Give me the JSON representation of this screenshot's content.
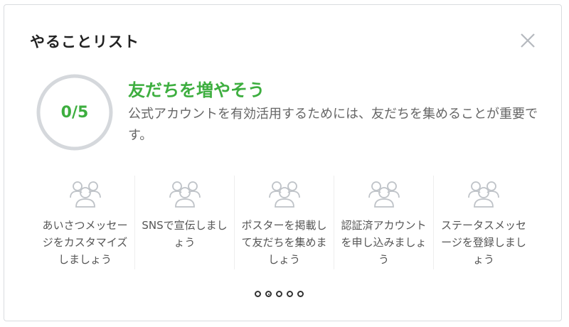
{
  "panel": {
    "title": "やることリスト",
    "close_icon": "close-icon"
  },
  "progress": {
    "text": "0/5",
    "completed": 0,
    "total": 5,
    "accent_color": "#3dae3f",
    "ring_color": "#d5d8dc"
  },
  "headline": "友だちを増やそう",
  "description": "公式アカウントを有効活用するためには、友だちを集めることが重要です。",
  "tasks": [
    {
      "icon": "people-group-icon",
      "label": "あいさつメッセージをカスタマイズしましょう"
    },
    {
      "icon": "people-group-icon",
      "label": "SNSで宣伝しましょう"
    },
    {
      "icon": "people-group-icon",
      "label": "ポスターを掲載して友だちを集めましょう"
    },
    {
      "icon": "people-group-icon",
      "label": "認証済アカウントを申し込みましょう"
    },
    {
      "icon": "people-group-icon",
      "label": "ステータスメッセージを登録しましょう"
    }
  ],
  "pagination": {
    "total_pages": 5,
    "active_page": 2
  }
}
